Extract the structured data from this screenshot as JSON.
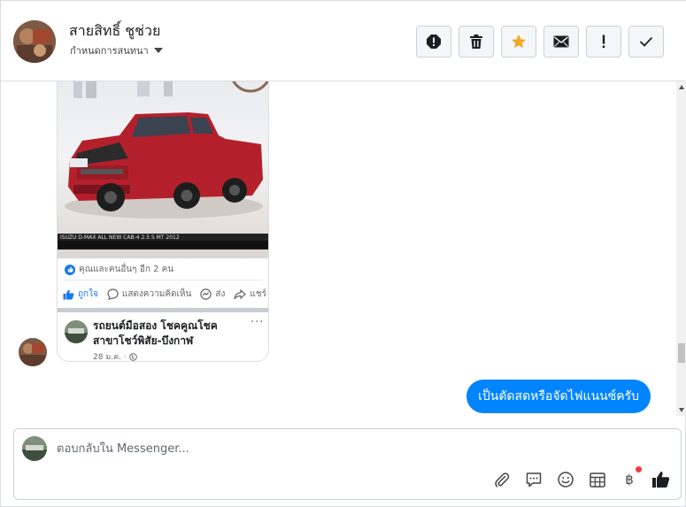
{
  "header": {
    "contact_name": "สายสิทธิ์ ชูช่วย",
    "assign_label": "กำหนดการสนทนา",
    "actions": [
      {
        "icon": "alert-circle-icon"
      },
      {
        "icon": "trash-icon"
      },
      {
        "icon": "star-icon"
      },
      {
        "icon": "envelope-icon"
      },
      {
        "icon": "exclamation-icon"
      },
      {
        "icon": "check-icon"
      }
    ]
  },
  "shared_post": {
    "image_caption": "ISUZU D-MAX ALL NEW CAB-4 2.5 S MT 2012",
    "reactions_text": "คุณและคนอื่นๆ อีก 2 คน",
    "like_label": "ถูกใจ",
    "comment_label": "แสดงความคิดเห็น",
    "send_label": "ส่ง",
    "share_label": "แชร์",
    "page_name": "รถยนต์มือสอง โชคคูณโชค สาขาโชว์พิสัย-บึงกาฬ",
    "date": "28 ม.ค. ·"
  },
  "outgoing_message": {
    "text": "เป็นตัดสดหรือจัดไฟแนนซ์ครับ"
  },
  "composer": {
    "placeholder": "ตอบกลับใน Messenger...",
    "tools": [
      "attach-icon",
      "saved-reply-icon",
      "emoji-icon",
      "calendar-icon",
      "baht-payment-icon",
      "thumbs-up-icon"
    ],
    "baht_symbol": "฿"
  },
  "colors": {
    "accent": "#0084ff",
    "star": "#f5a623",
    "like_blue": "#1877f2",
    "badge_red": "#fa383e"
  }
}
